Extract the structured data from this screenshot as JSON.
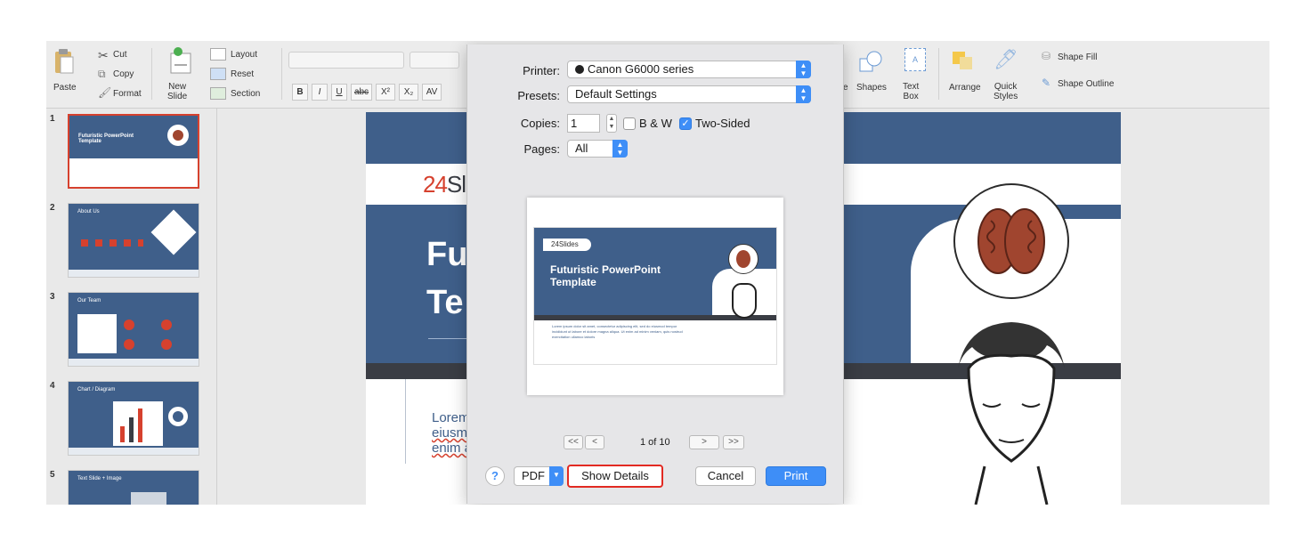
{
  "ribbon": {
    "paste": "Paste",
    "cut": "Cut",
    "copy": "Copy",
    "format": "Format",
    "new_slide": "New\nSlide",
    "layout": "Layout",
    "reset": "Reset",
    "section": "Section",
    "bold": "B",
    "italic": "I",
    "underline": "U",
    "strike": "abc",
    "superscript": "X²",
    "subscript": "X₂",
    "spacing": "AV",
    "shapes": "Shapes",
    "text_box": "Text\nBox",
    "arrange": "Arrange",
    "quick_styles": "Quick\nStyles",
    "shape_fill": "Shape Fill",
    "shape_outline": "Shape Outline",
    "shape_letter": "e"
  },
  "thumbnails": [
    {
      "num": "1",
      "title": "Futuristic PowerPoint Template"
    },
    {
      "num": "2",
      "title": "About Us"
    },
    {
      "num": "3",
      "title": "Our Team"
    },
    {
      "num": "4",
      "title": "Chart / Diagram"
    },
    {
      "num": "5",
      "title": "Text Slide + Image"
    }
  ],
  "slide": {
    "logo_num": "24",
    "logo_text": "Slid",
    "title": "Fu\nTe",
    "body_line1": "Lorem",
    "body_line2": "eiusm",
    "body_line3": "enim a"
  },
  "dialog": {
    "printer_label": "Printer:",
    "printer_value": "Canon G6000 series",
    "presets_label": "Presets:",
    "presets_value": "Default Settings",
    "copies_label": "Copies:",
    "copies_value": "1",
    "bw_label": "B & W",
    "bw_checked": false,
    "two_sided_label": "Two-Sided",
    "two_sided_checked": true,
    "pages_label": "Pages:",
    "pages_value": "All",
    "preview_logo": "24Slides",
    "preview_title": "Futuristic PowerPoint\nTemplate",
    "preview_body": "Lorem ipsum dolor sit amet, consectetur adipiscing elit, sed do eiusmod tempor incididunt ut labore et dolore magna aliqua. Ut enim ad minim veniam, quis nostrud exercitation ullamco laboris",
    "first_page": "<<",
    "prev_page": "<",
    "page_indicator": "1 of 10",
    "next_page": ">",
    "last_page": ">>",
    "help": "?",
    "pdf": "PDF",
    "show_details": "Show Details",
    "cancel": "Cancel",
    "print": "Print"
  },
  "colors": {
    "accent_blue": "#3e8ef7",
    "slide_blue": "#3f5f8a",
    "brand_red": "#d6412e",
    "highlight_red": "#e22a22"
  }
}
